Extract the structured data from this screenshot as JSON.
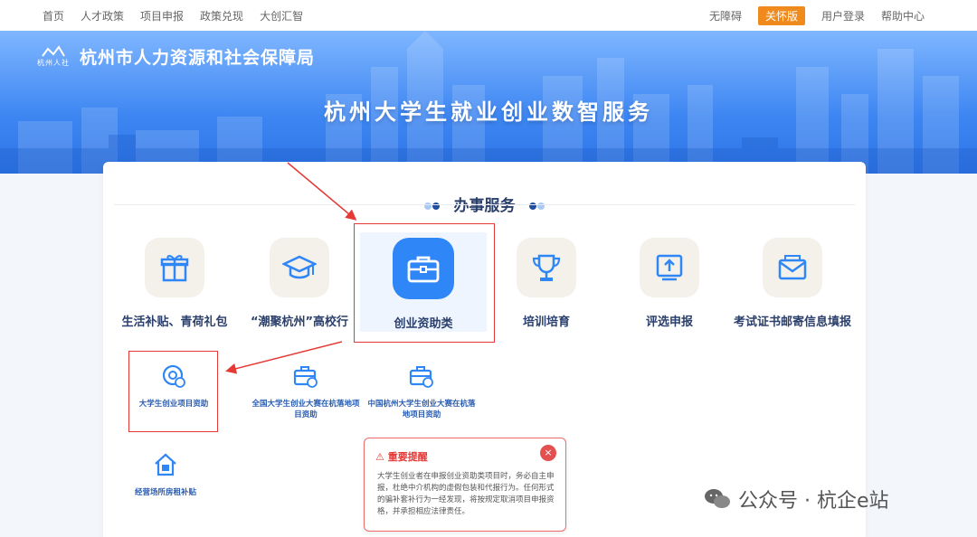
{
  "topnav": {
    "left": [
      "首页",
      "人才政策",
      "项目申报",
      "政策兑现",
      "大创汇智"
    ],
    "accessibility": "无障碍",
    "care_mode": "关怀版",
    "login": "用户登录",
    "help": "帮助中心"
  },
  "header": {
    "logo_caption": "杭州人社",
    "org_name": "杭州市人力资源和社会保障局",
    "banner_title": "杭州大学生就业创业数智服务"
  },
  "section": {
    "title": "办事服务"
  },
  "services": [
    {
      "label": "生活补贴、青荷礼包",
      "icon": "gift-icon"
    },
    {
      "label": "“潮聚杭州”高校行",
      "icon": "graduation-cap-icon"
    },
    {
      "label": "创业资助类",
      "icon": "briefcase-icon"
    },
    {
      "label": "培训培育",
      "icon": "trophy-icon"
    },
    {
      "label": "评选申报",
      "icon": "upload-icon"
    },
    {
      "label": "考试证书邮寄信息填报",
      "icon": "mail-icon"
    }
  ],
  "subitems": [
    {
      "label": "大学生创业项目资助",
      "icon": "money-icon"
    },
    {
      "label": "全国大学生创业大赛在杭落地项目资助",
      "icon": "briefcase-money-icon"
    },
    {
      "label": "中国杭州大学生创业大赛在杭落地项目资助",
      "icon": "briefcase-money-icon"
    },
    {
      "label": "经营场所房租补贴",
      "icon": "house-icon"
    }
  ],
  "notice": {
    "title": "重要提醒",
    "body": "大学生创业者在申报创业资助类项目时，务必自主申报，杜绝中介机构的虚假包装和代报行为。任何形式的骗补套补行为一经发现，将按规定取消项目申报资格，并承担相应法律责任。",
    "close": "×"
  },
  "watermark": {
    "text": "公众号 · 杭企e站"
  },
  "colors": {
    "accent": "#2f86f6",
    "care": "#f08a1c",
    "alert": "#e53935"
  }
}
